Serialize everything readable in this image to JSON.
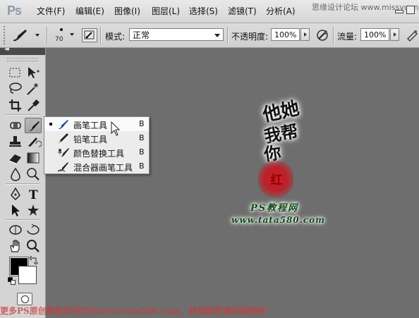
{
  "app": {
    "logo": "Ps"
  },
  "menu": [
    {
      "label": "文件(F)",
      "key": "file"
    },
    {
      "label": "编辑(E)",
      "key": "edit"
    },
    {
      "label": "图像(I)",
      "key": "image"
    },
    {
      "label": "图层(L)",
      "key": "layer"
    },
    {
      "label": "选择(S)",
      "key": "select"
    },
    {
      "label": "滤镜(T)",
      "key": "filter"
    },
    {
      "label": "分析(A)",
      "key": "analysis"
    }
  ],
  "top_watermark": "思缘设计论坛 www.missyuan.com",
  "options_bar": {
    "brush_size": "70",
    "mode_label": "模式:",
    "mode_value": "正常",
    "opacity_label": "不透明度:",
    "opacity_value": "100%",
    "flow_label": "流量:",
    "flow_value": "100%"
  },
  "tool_flyout": {
    "items": [
      {
        "label": "画笔工具",
        "shortcut": "B",
        "selected": true,
        "icon": "brush-icon"
      },
      {
        "label": "铅笔工具",
        "shortcut": "B",
        "selected": false,
        "icon": "pencil-icon"
      },
      {
        "label": "颜色替换工具",
        "shortcut": "B",
        "selected": false,
        "icon": "color-replacement-icon"
      },
      {
        "label": "混合器画笔工具",
        "shortcut": "B",
        "selected": false,
        "icon": "mixer-brush-icon"
      }
    ]
  },
  "colors": {
    "foreground": "#000000",
    "background": "#ffffff",
    "canvas": "#6e6e6e"
  },
  "canvas": {
    "calligraphy_lines": [
      "他她",
      "我帮",
      "你"
    ],
    "seal_text": "红",
    "ps_label": "PS教程网",
    "url": "www.tata580.com"
  },
  "bottom_watermark": "更多PS原创教程欢迎访问www.tata580.com，转载教程请保留链接！"
}
